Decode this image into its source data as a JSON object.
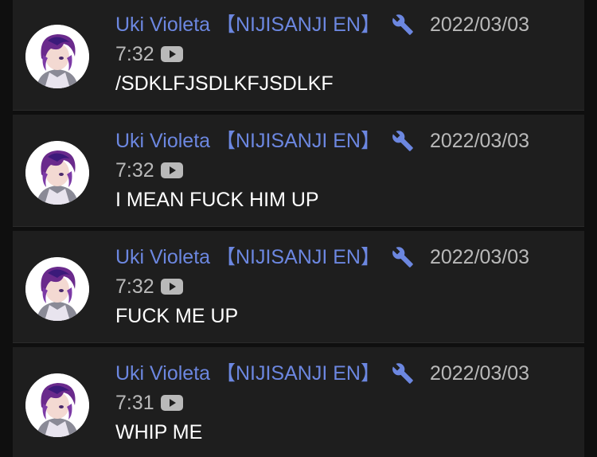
{
  "colors": {
    "author": "#6c87e0",
    "meta": "#b9b9b9",
    "message": "#ffffff",
    "card_bg": "#1e1e1e",
    "page_bg": "#0f0f0f"
  },
  "messages": [
    {
      "author": "Uki Violeta 【NIJISANJI EN】",
      "badge_icon": "wrench-icon",
      "date": "2022/03/03",
      "time": "7:32",
      "source_icon": "youtube-icon",
      "text": "/SDKLFJSDLKFJSDLKF"
    },
    {
      "author": "Uki Violeta 【NIJISANJI EN】",
      "badge_icon": "wrench-icon",
      "date": "2022/03/03",
      "time": "7:32",
      "source_icon": "youtube-icon",
      "text": "I MEAN FUCK HIM UP"
    },
    {
      "author": "Uki Violeta 【NIJISANJI EN】",
      "badge_icon": "wrench-icon",
      "date": "2022/03/03",
      "time": "7:32",
      "source_icon": "youtube-icon",
      "text": "FUCK ME UP"
    },
    {
      "author": "Uki Violeta 【NIJISANJI EN】",
      "badge_icon": "wrench-icon",
      "date": "2022/03/03",
      "time": "7:31",
      "source_icon": "youtube-icon",
      "text": "WHIP ME"
    }
  ]
}
